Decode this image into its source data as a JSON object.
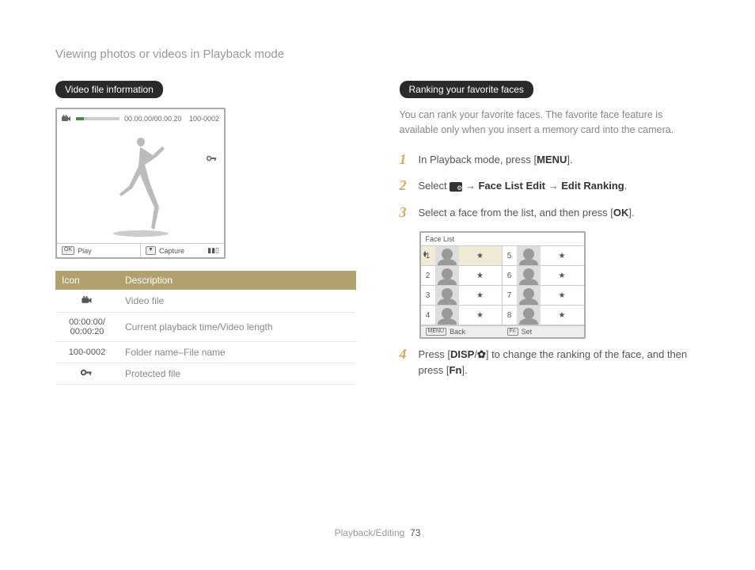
{
  "header": "Viewing photos or videos in Playback mode",
  "left": {
    "pill": "Video file information",
    "preview": {
      "time": "00.00.00/00.00.20",
      "file": "100-0002",
      "play": "Play",
      "capture": "Capture",
      "ok": "OK"
    },
    "table": {
      "h1": "Icon",
      "h2": "Description",
      "r1_desc": "Video file",
      "r2_icon": "00:00:00/ 00:00:20",
      "r2_desc": "Current playback time/Video length",
      "r3_icon": "100-0002",
      "r3_desc": "Folder name–File name",
      "r4_desc": "Protected file"
    }
  },
  "right": {
    "pill": "Ranking your favorite faces",
    "intro": "You can rank your favorite faces. The favorite face feature is available only when you insert a memory card into the camera.",
    "step1_a": "In Playback mode, press [",
    "step1_b": "MENU",
    "step1_c": "].",
    "step2_a": "Select ",
    "step2_b": " → ",
    "step2_c": "Face List Edit",
    "step2_d": " → ",
    "step2_e": "Edit Ranking",
    "step2_f": ".",
    "step3_a": "Select a face from the list, and then press [",
    "step3_b": "OK",
    "step3_c": "].",
    "facelist": {
      "header": "Face List",
      "nums": [
        "1",
        "2",
        "3",
        "4",
        "5",
        "6",
        "7",
        "8"
      ],
      "back": "Back",
      "menu": "MENU",
      "fn": "Fn",
      "set": "Set"
    },
    "step4_a": "Press [",
    "step4_b": "DISP",
    "step4_c": "/",
    "step4_d": "] to change the ranking of the face, and then press [",
    "step4_e": "Fn",
    "step4_f": "]."
  },
  "footer": {
    "section": "Playback/Editing",
    "page": "73"
  }
}
